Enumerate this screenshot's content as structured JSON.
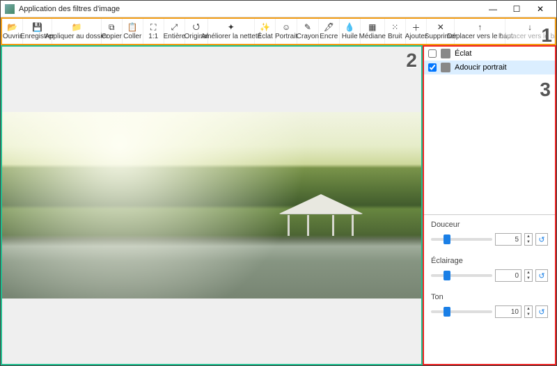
{
  "window": {
    "title": "Application des filtres d'image"
  },
  "toolbar": {
    "items": [
      {
        "label": "Ouvrir",
        "icon": "open-icon",
        "glyph": "📂"
      },
      {
        "label": "Enregistrer",
        "icon": "save-icon",
        "glyph": "💾"
      },
      {
        "label": "Appliquer au dossier",
        "icon": "apply-folder-icon",
        "glyph": "📁"
      },
      {
        "label": "Copier",
        "icon": "copy-icon",
        "glyph": "⧉"
      },
      {
        "label": "Coller",
        "icon": "paste-icon",
        "glyph": "📋"
      },
      {
        "label": "1:1",
        "icon": "zoom-actual-icon",
        "glyph": "⛶"
      },
      {
        "label": "Entière",
        "icon": "zoom-fit-icon",
        "glyph": "⤢"
      },
      {
        "label": "Original",
        "icon": "original-icon",
        "glyph": "⭯"
      },
      {
        "label": "Améliorer la netteté",
        "icon": "sharpen-icon",
        "glyph": "✦"
      },
      {
        "label": "Éclat",
        "icon": "glow-icon",
        "glyph": "✨"
      },
      {
        "label": "Portrait",
        "icon": "portrait-icon",
        "glyph": "☺"
      },
      {
        "label": "Crayon",
        "icon": "pencil-icon",
        "glyph": "✎"
      },
      {
        "label": "Encre",
        "icon": "ink-icon",
        "glyph": "🖋"
      },
      {
        "label": "Huile",
        "icon": "oil-icon",
        "glyph": "💧"
      },
      {
        "label": "Médiane",
        "icon": "median-icon",
        "glyph": "▦"
      },
      {
        "label": "Bruit",
        "icon": "noise-icon",
        "glyph": "⁙"
      },
      {
        "label": "Ajouter",
        "icon": "add-icon",
        "glyph": "＋"
      },
      {
        "label": "Supprimer",
        "icon": "delete-icon",
        "glyph": "✕"
      },
      {
        "label": "Déplacer vers le haut",
        "icon": "move-up-icon",
        "glyph": "↑"
      },
      {
        "label": "Déplacer vers le bas",
        "icon": "move-down-icon",
        "glyph": "↓",
        "disabled": true
      }
    ]
  },
  "annotations": {
    "a1": "1",
    "a2": "2",
    "a3": "3"
  },
  "filters": {
    "items": [
      {
        "label": "Éclat",
        "checked": false,
        "selected": false
      },
      {
        "label": "Adoucir portrait",
        "checked": true,
        "selected": true
      }
    ]
  },
  "params": {
    "items": [
      {
        "label": "Douceur",
        "value": 5,
        "min": 0,
        "max": 20,
        "pos_pct": 26
      },
      {
        "label": "Éclairage",
        "value": 0,
        "min": -10,
        "max": 10,
        "pos_pct": 26
      },
      {
        "label": "Ton",
        "value": 10,
        "min": 0,
        "max": 40,
        "pos_pct": 26
      }
    ]
  },
  "colors": {
    "annot_toolbar": "#f39c12",
    "annot_canvas": "#1fbf8f",
    "annot_side": "#e22",
    "slider_thumb": "#1a7fe6"
  }
}
